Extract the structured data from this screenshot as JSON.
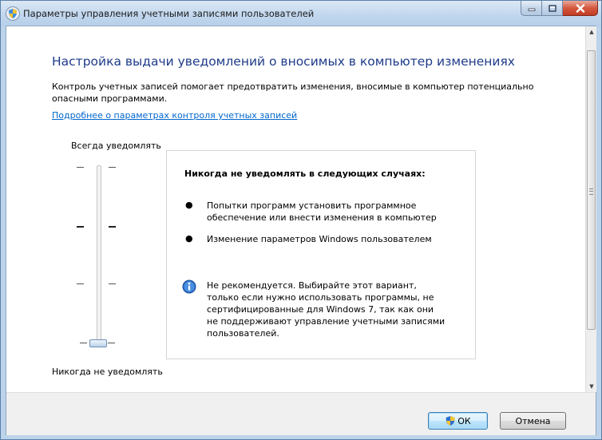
{
  "window": {
    "title": "Параметры управления учетными записями пользователей"
  },
  "main": {
    "heading": "Настройка выдачи уведомлений о вносимых в компьютер изменениях",
    "description": "Контроль учетных записей помогает предотвратить изменения, вносимые в компьютер потенциально опасными программами.",
    "link": "Подробнее о параметрах контроля учетных записей"
  },
  "slider": {
    "top_label": "Всегда уведомлять",
    "bottom_label": "Никогда не уведомлять",
    "levels": 4,
    "selected_level": 1
  },
  "panel": {
    "title": "Никогда не уведомлять в следующих случаях:",
    "bullets": [
      "Попытки программ установить программное обеспечение или внести изменения в компьютер",
      "Изменение параметров Windows пользователем"
    ],
    "info": "Не рекомендуется. Выбирайте этот вариант, только если нужно использовать программы, не сертифицированные для Windows 7, так как они не поддерживают управление учетными записями пользователей."
  },
  "buttons": {
    "ok": "ОК",
    "cancel": "Отмена"
  },
  "icons": {
    "title": "uac-shield-icon",
    "info": "info-icon",
    "ok_button": "uac-shield-icon"
  }
}
